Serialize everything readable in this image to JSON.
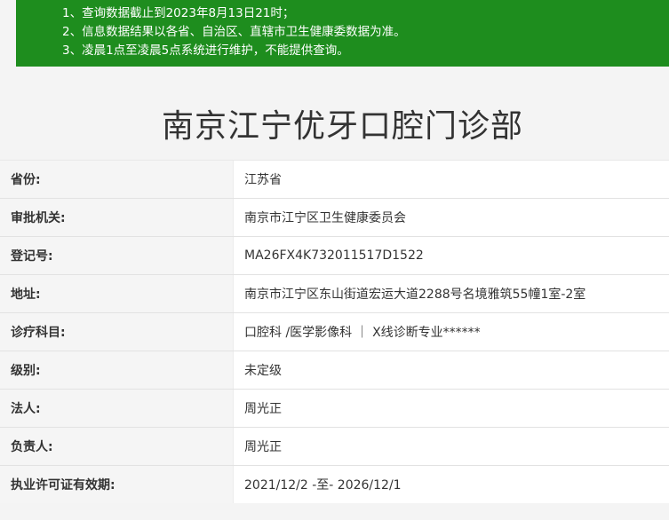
{
  "notice": {
    "lines": [
      "1、查询数据截止到2023年8月13日21时；",
      "2、信息数据结果以各省、自治区、直辖市卫生健康委数据为准。",
      "3、凌晨1点至凌晨5点系统进行维护，不能提供查询。"
    ]
  },
  "title": "南京江宁优牙口腔门诊部",
  "rows": [
    {
      "label": "省份:",
      "value": "江苏省"
    },
    {
      "label": "审批机关:",
      "value": "南京市江宁区卫生健康委员会"
    },
    {
      "label": "登记号:",
      "value": "MA26FX4K732011517D1522"
    },
    {
      "label": "地址:",
      "value": "南京市江宁区东山街道宏运大道2288号名境雅筑55幢1室-2室"
    },
    {
      "label": "诊疗科目:",
      "value": "口腔科 /医学影像科 ｜ X线诊断专业******"
    },
    {
      "label": "级别:",
      "value": "未定级"
    },
    {
      "label": "法人:",
      "value": "周光正"
    },
    {
      "label": "负责人:",
      "value": "周光正"
    },
    {
      "label": "执业许可证有效期:",
      "value": "2021/12/2 -至- 2026/12/1"
    }
  ],
  "colors": {
    "notice_bg": "#1e8d1e",
    "label_bg": "#f5f5f5",
    "value_bg": "#ffffff"
  }
}
